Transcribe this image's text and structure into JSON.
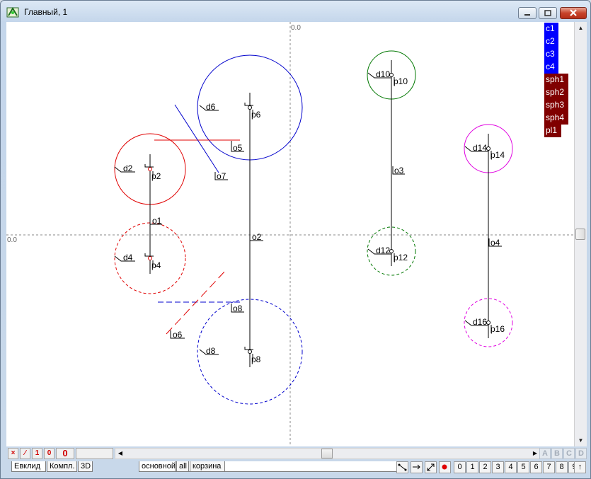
{
  "window": {
    "title": "Главный, 1"
  },
  "canvas": {
    "origin_x_label": "0.0",
    "origin_y_label": "0.0",
    "labels": [
      "p2",
      "p4",
      "p6",
      "p8",
      "p10",
      "p12",
      "p14",
      "p16",
      "d2",
      "d4",
      "d6",
      "d8",
      "d10",
      "d12",
      "d14",
      "d16",
      "o1",
      "o2",
      "o3",
      "o4",
      "o5",
      "o6",
      "o7",
      "o8"
    ]
  },
  "legend": {
    "items": [
      "c1",
      "c2",
      "c3",
      "c4",
      "sph1",
      "sph2",
      "sph3",
      "sph4",
      "pl1"
    ],
    "colors": {
      "c": "#0000ff",
      "sph": "#800000",
      "pl": "#800000"
    }
  },
  "status_bar": {
    "items": [
      "×",
      "∕",
      "1",
      "0",
      "0"
    ]
  },
  "mode_tabs": [
    "Евклид",
    "Компл.",
    "3D"
  ],
  "layer_tabs": [
    "основной",
    "all",
    "корзина"
  ],
  "layer_buttons": [
    "A",
    "B",
    "C",
    "D"
  ],
  "number_buttons": [
    "0",
    "1",
    "2",
    "3",
    "4",
    "5",
    "6",
    "7",
    "8",
    "9",
    "↑"
  ],
  "colors": {
    "circle_red": "#e00000",
    "circle_blue": "#0000cc",
    "circle_green": "#007700",
    "circle_magenta": "#e000e0"
  }
}
